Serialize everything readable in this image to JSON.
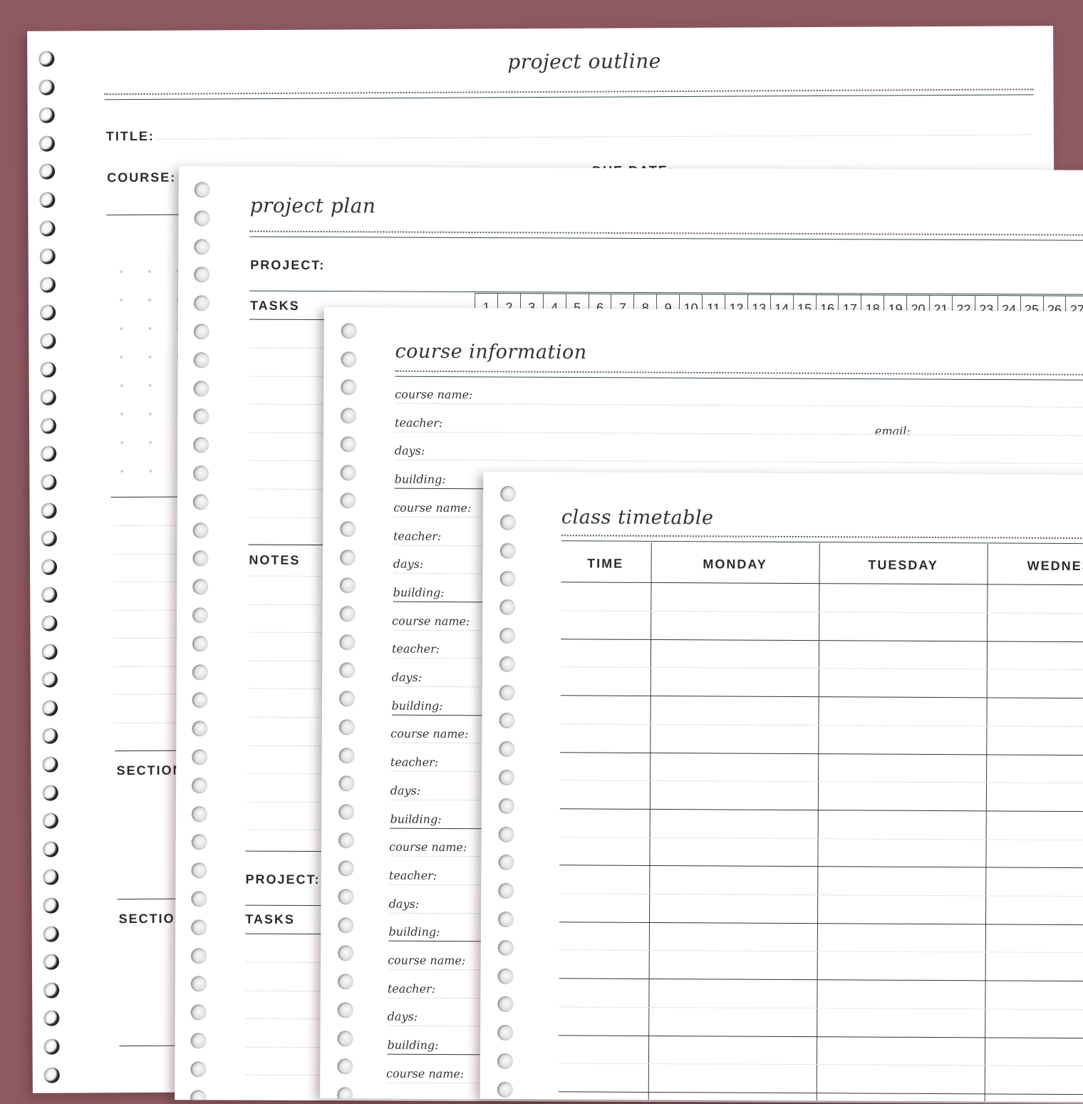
{
  "background_color": "#8e5a62",
  "project_outline": {
    "title": "project outline",
    "title_label": "TITLE:",
    "course_label": "COURSE:",
    "due_date_label": "DUE DATE:",
    "section_labels": [
      "SECTION",
      "SECTION"
    ]
  },
  "project_plan": {
    "title": "project plan",
    "project_label": "PROJECT:",
    "tasks_label": "TASKS",
    "notes_label": "NOTES",
    "project_label_2": "PROJECT:",
    "tasks_label_2": "TASKS",
    "days": [
      "1",
      "2",
      "3",
      "4",
      "5",
      "6",
      "7",
      "8",
      "9",
      "10",
      "11",
      "12",
      "13",
      "14",
      "15",
      "16",
      "17",
      "18",
      "19",
      "20",
      "21",
      "22",
      "23",
      "24",
      "25",
      "26",
      "27"
    ]
  },
  "course_information": {
    "title": "course information",
    "course_name_label": "course name:",
    "teacher_label": "teacher:",
    "email_label": "email:",
    "days_label": "days:",
    "building_label": "building:"
  },
  "class_timetable": {
    "title": "class timetable",
    "columns": [
      "TIME",
      "MONDAY",
      "TUESDAY",
      "WEDNES"
    ]
  }
}
